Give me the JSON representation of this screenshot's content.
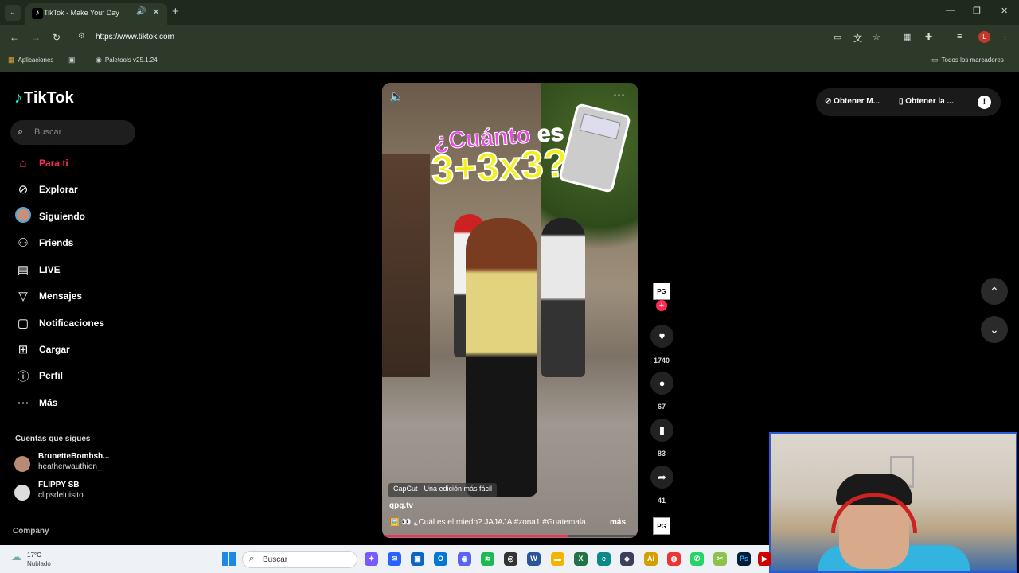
{
  "browser": {
    "tab": {
      "title": "TikTok - Make Your Day",
      "favicon": "tiktok-icon"
    },
    "url": "https://www.tiktok.com",
    "bookmarks": [
      {
        "label": "Aplicaciones",
        "icon": "apps-grid-icon"
      },
      {
        "label": "",
        "icon": "grid-icon"
      },
      {
        "label": "Paletools v25.1.24",
        "icon": "globe-icon"
      },
      {
        "label": "Todos los marcadores",
        "icon": "folder-icon"
      }
    ],
    "profile_initial": "L"
  },
  "sidebar": {
    "logo": "TikTok",
    "search_placeholder": "Buscar",
    "nav": [
      {
        "label": "Para ti",
        "icon": "home-icon",
        "active": true
      },
      {
        "label": "Explorar",
        "icon": "compass-icon",
        "active": false
      },
      {
        "label": "Siguiendo",
        "icon": "avatar-icon",
        "active": false
      },
      {
        "label": "Friends",
        "icon": "friends-icon",
        "active": false
      },
      {
        "label": "LIVE",
        "icon": "live-icon",
        "active": false
      },
      {
        "label": "Mensajes",
        "icon": "messages-icon",
        "active": false
      },
      {
        "label": "Notificaciones",
        "icon": "notifications-icon",
        "active": false
      },
      {
        "label": "Cargar",
        "icon": "upload-icon",
        "active": false
      },
      {
        "label": "Perfil",
        "icon": "profile-icon",
        "active": false
      },
      {
        "label": "Más",
        "icon": "more-icon",
        "active": false
      }
    ],
    "following_title": "Cuentas que sigues",
    "following": [
      {
        "name": "BrunetteBombsh...",
        "handle": "heatherwauthion_"
      },
      {
        "name": "FLIPPY SB",
        "handle": "clipsdeluisito"
      }
    ],
    "company": "Company"
  },
  "video": {
    "overlay_line1_a": "¿Cuánto",
    "overlay_line1_b": "es",
    "overlay_line2": "3+3x3?",
    "capcut": "CapCut · Una edición más fácil",
    "author": "qpg.tv",
    "caption": "🖼️ 👀 ¿Cuál es el miedo? JAJAJA #zona1 #Guatemala...",
    "caption_more": "más",
    "progress": 0.73,
    "creator_badge": "PG"
  },
  "actions": {
    "likes": "1740",
    "comments": "67",
    "saves": "83",
    "shares": "41"
  },
  "topbar": {
    "get_app_1": "Obtener M...",
    "get_app_2": "Obtener la ..."
  },
  "taskbar": {
    "temp": "17°C",
    "condition": "Nublado",
    "search_label": "Buscar"
  },
  "colors": {
    "accent": "#fe2c55",
    "cyan": "#25f4ee"
  }
}
